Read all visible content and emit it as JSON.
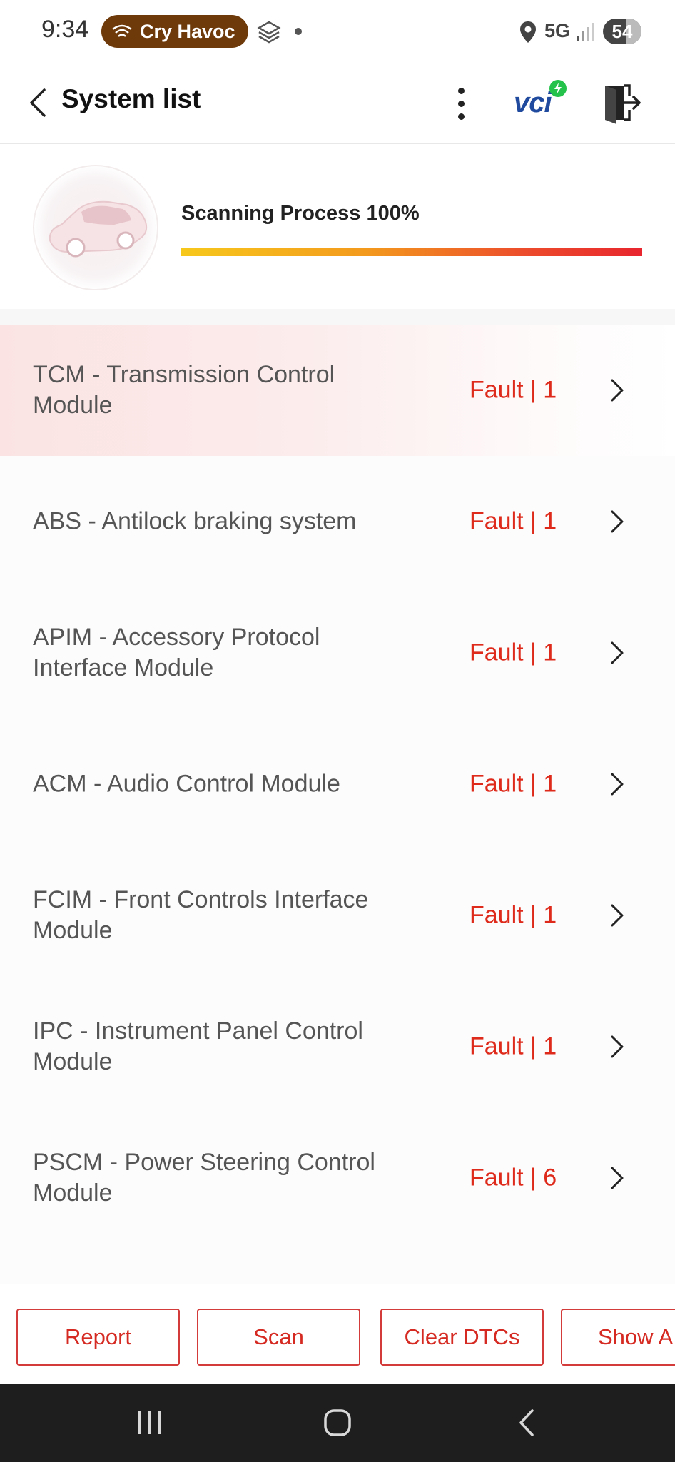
{
  "status_bar": {
    "time": "9:34",
    "app_pill_label": "Cry Havoc",
    "network": "5G",
    "battery": "54"
  },
  "header": {
    "title": "System list",
    "vci_label": "vci"
  },
  "scan": {
    "label": "Scanning Process 100%",
    "progress_percent": 100
  },
  "systems": [
    {
      "name": "TCM - Transmission Control Module",
      "status": "Fault | 1"
    },
    {
      "name": "ABS - Antilock braking system",
      "status": "Fault | 1"
    },
    {
      "name": "APIM - Accessory Protocol Interface Module",
      "status": "Fault | 1"
    },
    {
      "name": "ACM - Audio Control Module",
      "status": "Fault | 1"
    },
    {
      "name": "FCIM - Front Controls Interface Module",
      "status": "Fault | 1"
    },
    {
      "name": "IPC - Instrument Panel Control Module",
      "status": "Fault | 1"
    },
    {
      "name": "PSCM - Power Steering Control Module",
      "status": "Fault | 6"
    }
  ],
  "actions": {
    "report": "Report",
    "scan": "Scan",
    "clear_dtcs": "Clear DTCs",
    "show_all": "Show A"
  },
  "colors": {
    "accent_red": "#dd2a1b",
    "vci_blue": "#1f4a9e",
    "pill_brown": "#6e3a0a"
  },
  "icons": {
    "back": "chevron-left-icon",
    "more": "more-vertical-icon",
    "exit": "exit-icon",
    "row": "chevron-right-icon"
  }
}
